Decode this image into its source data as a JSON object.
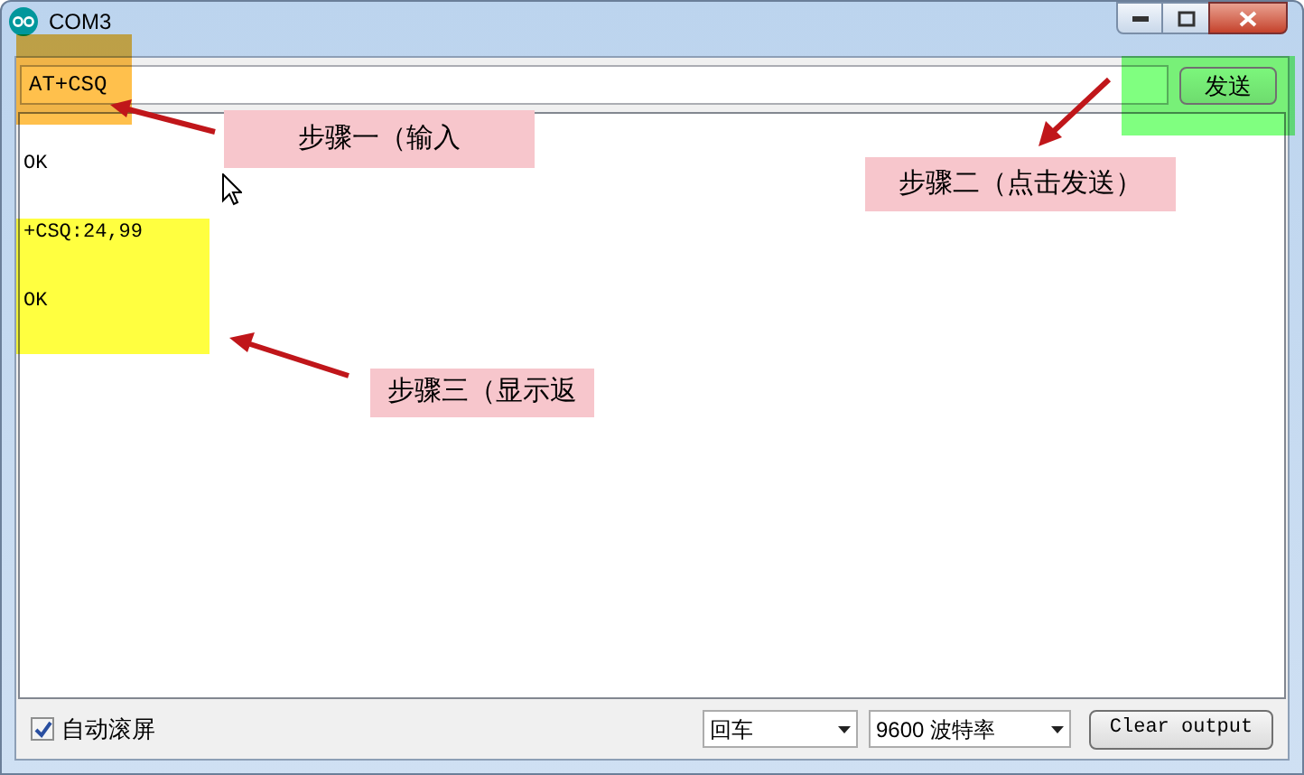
{
  "window": {
    "title": "COM3"
  },
  "input": {
    "value": "AT+CSQ"
  },
  "send_button": "发送",
  "output_lines": [
    "OK",
    "+CSQ:24,99",
    "OK"
  ],
  "highlights": [
    {
      "color": "#ffc04c"
    },
    {
      "color": "#80ff80"
    },
    {
      "color": "#ffff40"
    }
  ],
  "annotations": [
    "步骤一（输入",
    "步骤二（点击发送）",
    "步骤三（显示返"
  ],
  "footer": {
    "autoscroll": {
      "label": "自动滚屏",
      "checked": true
    },
    "line_ending": "回车",
    "baud_rate": "9600 波特率",
    "clear_button": "Clear output"
  }
}
